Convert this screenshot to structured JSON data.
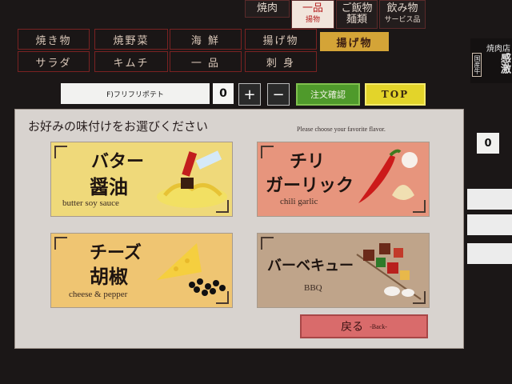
{
  "top_categories": [
    {
      "label": "焼肉",
      "sub": ""
    },
    {
      "label": "一品",
      "sub": "揚物"
    },
    {
      "label": "ご飯物",
      "sub": "麺類"
    },
    {
      "label": "飲み物",
      "sub": "サービス品"
    }
  ],
  "tabs_row1": [
    "焼き物",
    "焼野菜",
    "海 鮮",
    "揚げ物"
  ],
  "tab_selected": "揚げ物",
  "tabs_row2": [
    "サラダ",
    "キムチ",
    "一 品",
    "刺 身"
  ],
  "side_promo": {
    "line1": "焼肉店",
    "line2": "感激",
    "badge": "国産牛"
  },
  "order_bar": {
    "item_name": "F)フリフリポテト",
    "quantity": "0",
    "plus": "+",
    "minus": "−",
    "confirm_label": "注文確認",
    "top_label": "TOP"
  },
  "dialog": {
    "title": "お好みの味付けをお選びください",
    "subtitle": "Please choose your favorite flavor.",
    "options": [
      {
        "jp_line1": "バター",
        "jp_line2": "醤油",
        "en": "butter soy sauce",
        "color": "#efd97a"
      },
      {
        "jp_line1": "チリ",
        "jp_line2": "ガーリック",
        "en": "chili garlic",
        "color": "#e7957d"
      },
      {
        "jp_line1": "チーズ",
        "jp_line2": "胡椒",
        "en": "cheese & pepper",
        "color": "#efc572"
      },
      {
        "jp_line1": "バーベキュー",
        "jp_line2": "",
        "en": "BBQ",
        "color": "#bfa48a"
      }
    ],
    "back_label": "戻る",
    "back_sub": "-Back-"
  },
  "side_quantity": "0"
}
